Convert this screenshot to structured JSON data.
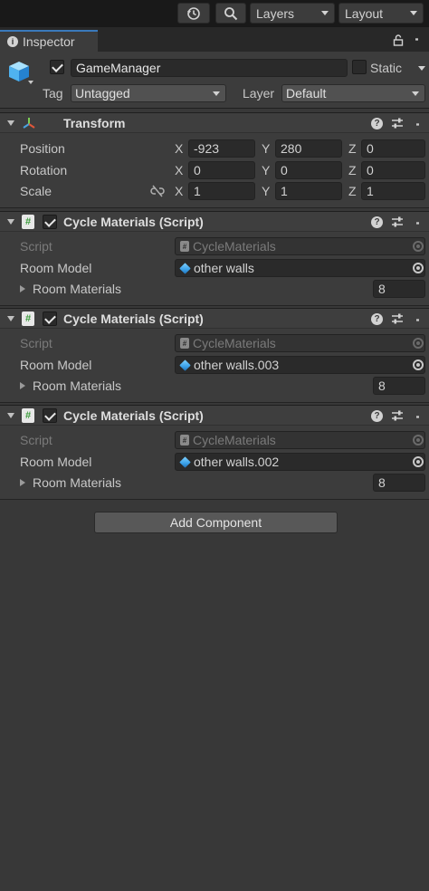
{
  "toolbar": {
    "layers_label": "Layers",
    "layout_label": "Layout"
  },
  "tab": {
    "label": "Inspector"
  },
  "object": {
    "name": "GameManager",
    "static_label": "Static",
    "tag_label": "Tag",
    "tag_value": "Untagged",
    "layer_label": "Layer",
    "layer_value": "Default"
  },
  "transform": {
    "title": "Transform",
    "position_label": "Position",
    "rotation_label": "Rotation",
    "scale_label": "Scale",
    "position": {
      "x": "-923",
      "y": "280",
      "z": "0"
    },
    "rotation": {
      "x": "0",
      "y": "0",
      "z": "0"
    },
    "scale": {
      "x": "1",
      "y": "1",
      "z": "1"
    },
    "axis_x": "X",
    "axis_y": "Y",
    "axis_z": "Z"
  },
  "components": [
    {
      "title": "Cycle Materials (Script)",
      "script_label": "Script",
      "script_value": "CycleMaterials",
      "room_model_label": "Room Model",
      "room_model_value": "other walls",
      "room_materials_label": "Room Materials",
      "room_materials_count": "8"
    },
    {
      "title": "Cycle Materials (Script)",
      "script_label": "Script",
      "script_value": "CycleMaterials",
      "room_model_label": "Room Model",
      "room_model_value": "other walls.003",
      "room_materials_label": "Room Materials",
      "room_materials_count": "8"
    },
    {
      "title": "Cycle Materials (Script)",
      "script_label": "Script",
      "script_value": "CycleMaterials",
      "room_model_label": "Room Model",
      "room_model_value": "other walls.002",
      "room_materials_label": "Room Materials",
      "room_materials_count": "8"
    }
  ],
  "add_component_label": "Add Component"
}
